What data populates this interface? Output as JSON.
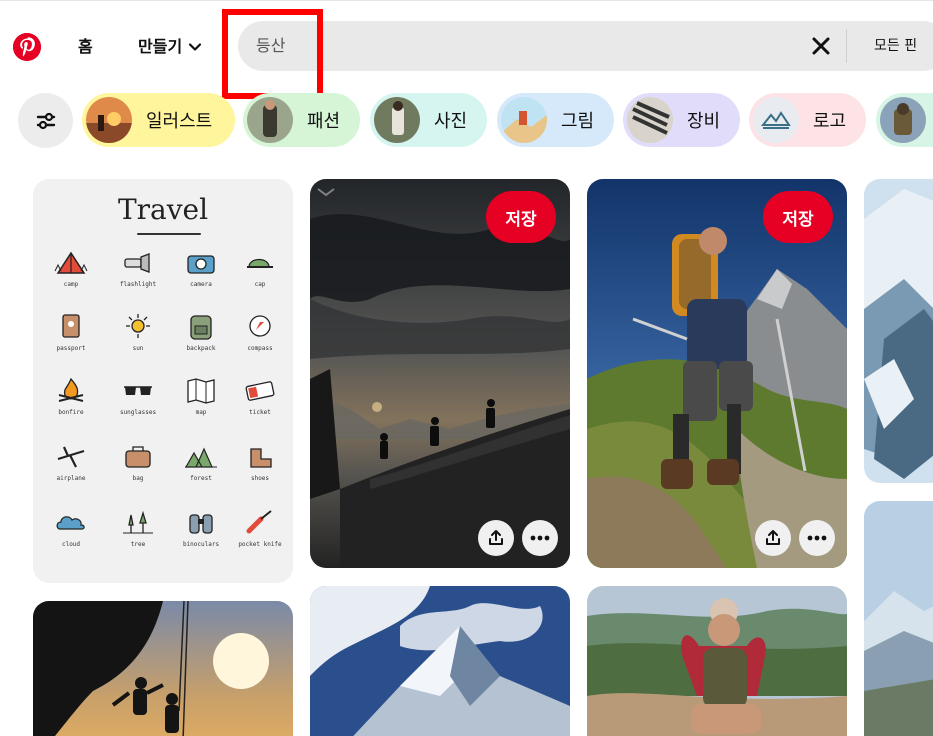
{
  "header": {
    "logo": "pinterest-logo",
    "home_label": "홈",
    "create_label": "만들기",
    "search": {
      "value": "등산"
    },
    "filter_label": "모든 핀"
  },
  "chips": [
    {
      "label": "일러스트",
      "color": "#fff59c"
    },
    {
      "label": "패션",
      "color": "#d6f5d6"
    },
    {
      "label": "사진",
      "color": "#d6f5f0"
    },
    {
      "label": "그림",
      "color": "#d6e9fb"
    },
    {
      "label": "장비",
      "color": "#e2dcfb"
    },
    {
      "label": "로고",
      "color": "#fde2e6"
    }
  ],
  "pins": {
    "save_label": "저장",
    "travel": {
      "title": "Travel",
      "items": [
        {
          "label": "camp",
          "icon": "tent-icon"
        },
        {
          "label": "flashlight",
          "icon": "flashlight-icon"
        },
        {
          "label": "camera",
          "icon": "camera-icon"
        },
        {
          "label": "cap",
          "icon": "cap-icon"
        },
        {
          "label": "passport",
          "icon": "passport-icon"
        },
        {
          "label": "sun",
          "icon": "sun-icon"
        },
        {
          "label": "backpack",
          "icon": "backpack-icon"
        },
        {
          "label": "compass",
          "icon": "compass-icon"
        },
        {
          "label": "bonfire",
          "icon": "bonfire-icon"
        },
        {
          "label": "sunglasses",
          "icon": "sunglasses-icon"
        },
        {
          "label": "map",
          "icon": "map-icon"
        },
        {
          "label": "ticket",
          "icon": "ticket-icon"
        },
        {
          "label": "airplane",
          "icon": "airplane-icon"
        },
        {
          "label": "bag",
          "icon": "bag-icon"
        },
        {
          "label": "forest",
          "icon": "forest-icon"
        },
        {
          "label": "shoes",
          "icon": "shoes-icon"
        },
        {
          "label": "cloud",
          "icon": "cloud-icon"
        },
        {
          "label": "tree",
          "icon": "tree-icon"
        },
        {
          "label": "binoculars",
          "icon": "binoculars-icon"
        },
        {
          "label": "pocket knife",
          "icon": "pocket-knife-icon"
        }
      ]
    }
  },
  "colors": {
    "brand": "#e60023",
    "highlight": "#ff0000",
    "search_bg": "#e9e9e9"
  }
}
